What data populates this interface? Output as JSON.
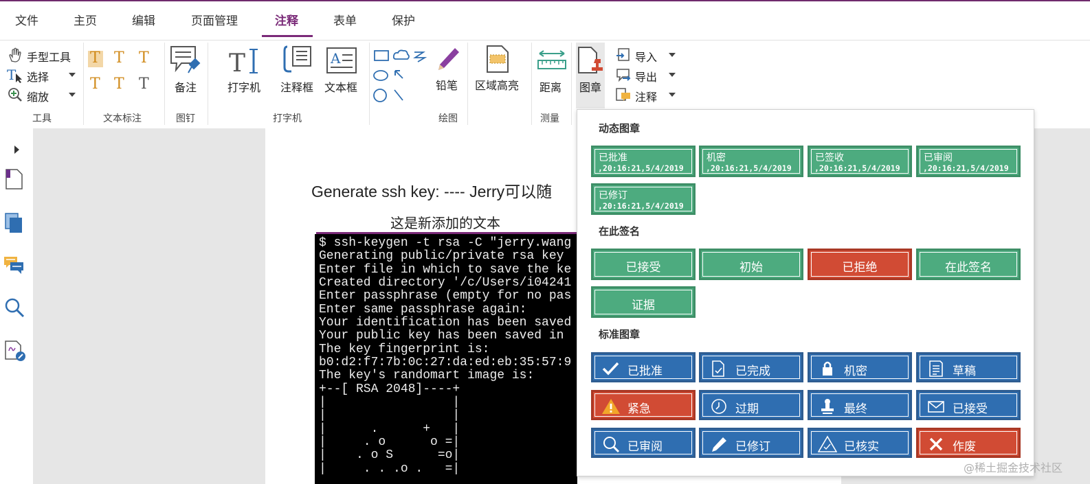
{
  "menu": {
    "tabs": [
      "文件",
      "主页",
      "编辑",
      "页面管理",
      "注释",
      "表单",
      "保护"
    ],
    "active": "注释"
  },
  "ribbon": {
    "tools": {
      "hand": "手型工具",
      "select": "选择",
      "zoom": "缩放",
      "label": "工具"
    },
    "text_markup_label": "文本标注",
    "pin": {
      "note": "备注",
      "label": "图钉"
    },
    "typewriter": {
      "typewriter": "打字机",
      "callout": "注释框",
      "textbox": "文本框",
      "label": "打字机"
    },
    "drawing": {
      "pencil": "铅笔",
      "label": "绘图"
    },
    "area_highlight": "区域高亮",
    "measure": {
      "distance": "距离",
      "label": "测量"
    },
    "stamp": "图章",
    "import": "导入",
    "export": "导出",
    "annotate": "注释"
  },
  "document": {
    "line1": "Generate ssh key: ---- Jerry可以随",
    "line2": "这是新添加的文本",
    "terminal": [
      "$ ssh-keygen -t rsa -C \"jerry.wang",
      "Generating public/private rsa key",
      "Enter file in which to save the ke",
      "Created directory '/c/Users/i04241",
      "Enter passphrase (empty for no pas",
      "Enter same passphrase again:",
      "Your identification has been saved",
      "Your public key has been saved in",
      "The key fingerprint is:",
      "b0:d2:f7:7b:0c:27:da:ed:eb:35:57:9",
      "The key's randomart image is:",
      "+--[ RSA 2048]----+",
      "|                 |",
      "|                 |",
      "|      .      +   |",
      "|     . o      o =|",
      "|    . o S      =o|",
      "|     . . .o .   =|"
    ]
  },
  "popup": {
    "dynamic_title": "动态图章",
    "dynamic_stamps": [
      {
        "name": "已批准",
        "time": ",20:16:21,5/4/2019"
      },
      {
        "name": "机密",
        "time": ",20:16:21,5/4/2019"
      },
      {
        "name": "已签收",
        "time": ",20:16:21,5/4/2019"
      },
      {
        "name": "已审阅",
        "time": ",20:16:21,5/4/2019"
      },
      {
        "name": "已修订",
        "time": ",20:16:21,5/4/2019"
      }
    ],
    "sign_title": "在此签名",
    "sign_stamps": [
      "已接受",
      "初始",
      "已拒绝",
      "在此签名",
      "证据"
    ],
    "standard_title": "标准图章",
    "standard_stamps": [
      "已批准",
      "已完成",
      "机密",
      "草稿",
      "紧急",
      "过期",
      "最终",
      "已接受",
      "已审阅",
      "已修订",
      "已核实",
      "作废"
    ]
  },
  "watermark": "@稀土掘金技术社区",
  "colors": {
    "accent": "#7a2a78",
    "green": "#4dab7f",
    "red": "#d14b34",
    "blue": "#2f6eb1"
  }
}
